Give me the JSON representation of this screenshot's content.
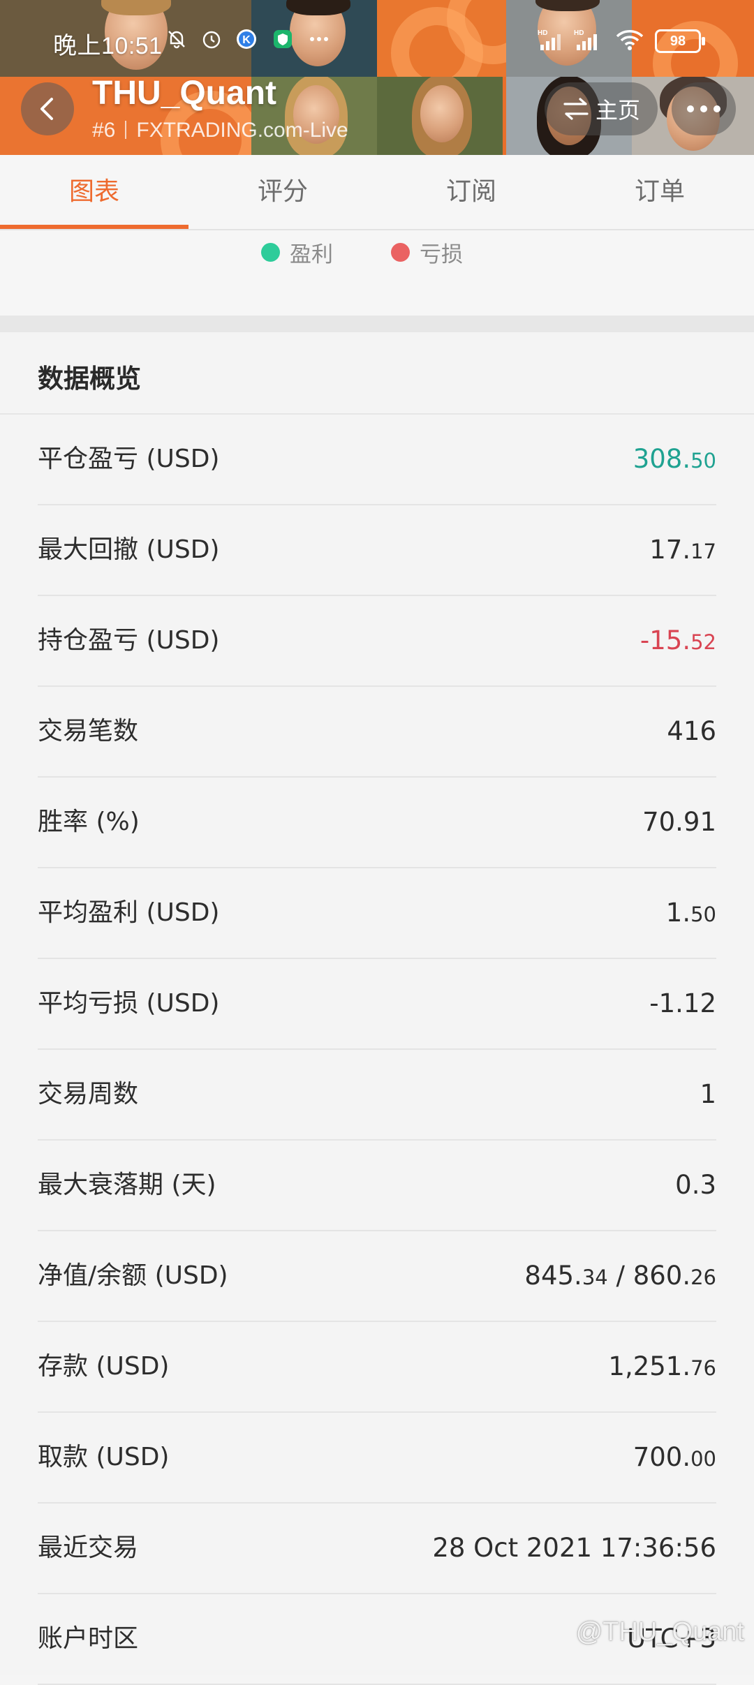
{
  "status_bar": {
    "time": "晚上10:51",
    "battery": "98"
  },
  "header": {
    "title": "THU_Quant",
    "rank": "#6",
    "broker": "FXTRADING.com-Live",
    "home_label": "主页"
  },
  "tabs": [
    {
      "label": "图表",
      "active": true
    },
    {
      "label": "评分",
      "active": false
    },
    {
      "label": "订阅",
      "active": false
    },
    {
      "label": "订单",
      "active": false
    }
  ],
  "legend": {
    "profit_label": "盈利",
    "loss_label": "亏损",
    "profit_color": "#2ecc9a",
    "loss_color": "#ea6262"
  },
  "overview": {
    "title": "数据概览",
    "rows": [
      {
        "label": "平仓盈亏 (USD)",
        "int": "308.",
        "dec": "50",
        "tone": "pos"
      },
      {
        "label": "最大回撤 (USD)",
        "int": "17.",
        "dec": "17",
        "tone": ""
      },
      {
        "label": "持仓盈亏 (USD)",
        "int": "-15.",
        "dec": "52",
        "tone": "neg"
      },
      {
        "label": "交易笔数",
        "int": "416",
        "dec": "",
        "tone": ""
      },
      {
        "label": "胜率 (%)",
        "int": "70.91",
        "dec": "",
        "tone": ""
      },
      {
        "label": "平均盈利 (USD)",
        "int": "1.",
        "dec": "50",
        "tone": ""
      },
      {
        "label": "平均亏损 (USD)",
        "int": "-1.12",
        "dec": "",
        "tone": ""
      },
      {
        "label": "交易周数",
        "int": "1",
        "dec": "",
        "tone": ""
      },
      {
        "label": "最大衰落期 (天)",
        "int": "0.3",
        "dec": "",
        "tone": ""
      },
      {
        "label": "净值/余额 (USD)",
        "int": "845.",
        "dec": "34",
        "int2": " / 860.",
        "dec2": "26",
        "tone": ""
      },
      {
        "label": "存款 (USD)",
        "int": "1,251.",
        "dec": "76",
        "tone": ""
      },
      {
        "label": "取款 (USD)",
        "int": "700.",
        "dec": "00",
        "tone": ""
      },
      {
        "label": "最近交易",
        "int": "28 Oct 2021 17:36:56",
        "dec": "",
        "tone": ""
      },
      {
        "label": "账户时区",
        "int": "UTC+3",
        "dec": "",
        "tone": ""
      }
    ]
  },
  "watermark": "@THU_Quant"
}
